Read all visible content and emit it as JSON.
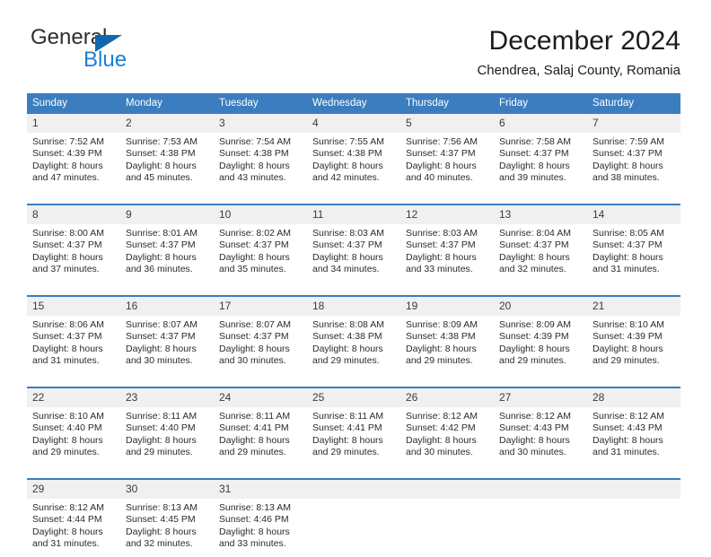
{
  "brand": {
    "name_top": "General",
    "name_bottom": "Blue",
    "color_dark": "#2e2e2e",
    "color_blue": "#1b7fd4",
    "triangle_color": "#1266ae"
  },
  "header": {
    "title": "December 2024",
    "subtitle": "Chendrea, Salaj County, Romania"
  },
  "calendar": {
    "header_bg": "#3b7dbf",
    "day_band_bg": "#f0f0f0",
    "weekdays": [
      "Sunday",
      "Monday",
      "Tuesday",
      "Wednesday",
      "Thursday",
      "Friday",
      "Saturday"
    ],
    "weeks": [
      [
        {
          "day": "1",
          "sunrise": "Sunrise: 7:52 AM",
          "sunset": "Sunset: 4:39 PM",
          "daylight1": "Daylight: 8 hours",
          "daylight2": "and 47 minutes."
        },
        {
          "day": "2",
          "sunrise": "Sunrise: 7:53 AM",
          "sunset": "Sunset: 4:38 PM",
          "daylight1": "Daylight: 8 hours",
          "daylight2": "and 45 minutes."
        },
        {
          "day": "3",
          "sunrise": "Sunrise: 7:54 AM",
          "sunset": "Sunset: 4:38 PM",
          "daylight1": "Daylight: 8 hours",
          "daylight2": "and 43 minutes."
        },
        {
          "day": "4",
          "sunrise": "Sunrise: 7:55 AM",
          "sunset": "Sunset: 4:38 PM",
          "daylight1": "Daylight: 8 hours",
          "daylight2": "and 42 minutes."
        },
        {
          "day": "5",
          "sunrise": "Sunrise: 7:56 AM",
          "sunset": "Sunset: 4:37 PM",
          "daylight1": "Daylight: 8 hours",
          "daylight2": "and 40 minutes."
        },
        {
          "day": "6",
          "sunrise": "Sunrise: 7:58 AM",
          "sunset": "Sunset: 4:37 PM",
          "daylight1": "Daylight: 8 hours",
          "daylight2": "and 39 minutes."
        },
        {
          "day": "7",
          "sunrise": "Sunrise: 7:59 AM",
          "sunset": "Sunset: 4:37 PM",
          "daylight1": "Daylight: 8 hours",
          "daylight2": "and 38 minutes."
        }
      ],
      [
        {
          "day": "8",
          "sunrise": "Sunrise: 8:00 AM",
          "sunset": "Sunset: 4:37 PM",
          "daylight1": "Daylight: 8 hours",
          "daylight2": "and 37 minutes."
        },
        {
          "day": "9",
          "sunrise": "Sunrise: 8:01 AM",
          "sunset": "Sunset: 4:37 PM",
          "daylight1": "Daylight: 8 hours",
          "daylight2": "and 36 minutes."
        },
        {
          "day": "10",
          "sunrise": "Sunrise: 8:02 AM",
          "sunset": "Sunset: 4:37 PM",
          "daylight1": "Daylight: 8 hours",
          "daylight2": "and 35 minutes."
        },
        {
          "day": "11",
          "sunrise": "Sunrise: 8:03 AM",
          "sunset": "Sunset: 4:37 PM",
          "daylight1": "Daylight: 8 hours",
          "daylight2": "and 34 minutes."
        },
        {
          "day": "12",
          "sunrise": "Sunrise: 8:03 AM",
          "sunset": "Sunset: 4:37 PM",
          "daylight1": "Daylight: 8 hours",
          "daylight2": "and 33 minutes."
        },
        {
          "day": "13",
          "sunrise": "Sunrise: 8:04 AM",
          "sunset": "Sunset: 4:37 PM",
          "daylight1": "Daylight: 8 hours",
          "daylight2": "and 32 minutes."
        },
        {
          "day": "14",
          "sunrise": "Sunrise: 8:05 AM",
          "sunset": "Sunset: 4:37 PM",
          "daylight1": "Daylight: 8 hours",
          "daylight2": "and 31 minutes."
        }
      ],
      [
        {
          "day": "15",
          "sunrise": "Sunrise: 8:06 AM",
          "sunset": "Sunset: 4:37 PM",
          "daylight1": "Daylight: 8 hours",
          "daylight2": "and 31 minutes."
        },
        {
          "day": "16",
          "sunrise": "Sunrise: 8:07 AM",
          "sunset": "Sunset: 4:37 PM",
          "daylight1": "Daylight: 8 hours",
          "daylight2": "and 30 minutes."
        },
        {
          "day": "17",
          "sunrise": "Sunrise: 8:07 AM",
          "sunset": "Sunset: 4:37 PM",
          "daylight1": "Daylight: 8 hours",
          "daylight2": "and 30 minutes."
        },
        {
          "day": "18",
          "sunrise": "Sunrise: 8:08 AM",
          "sunset": "Sunset: 4:38 PM",
          "daylight1": "Daylight: 8 hours",
          "daylight2": "and 29 minutes."
        },
        {
          "day": "19",
          "sunrise": "Sunrise: 8:09 AM",
          "sunset": "Sunset: 4:38 PM",
          "daylight1": "Daylight: 8 hours",
          "daylight2": "and 29 minutes."
        },
        {
          "day": "20",
          "sunrise": "Sunrise: 8:09 AM",
          "sunset": "Sunset: 4:39 PM",
          "daylight1": "Daylight: 8 hours",
          "daylight2": "and 29 minutes."
        },
        {
          "day": "21",
          "sunrise": "Sunrise: 8:10 AM",
          "sunset": "Sunset: 4:39 PM",
          "daylight1": "Daylight: 8 hours",
          "daylight2": "and 29 minutes."
        }
      ],
      [
        {
          "day": "22",
          "sunrise": "Sunrise: 8:10 AM",
          "sunset": "Sunset: 4:40 PM",
          "daylight1": "Daylight: 8 hours",
          "daylight2": "and 29 minutes."
        },
        {
          "day": "23",
          "sunrise": "Sunrise: 8:11 AM",
          "sunset": "Sunset: 4:40 PM",
          "daylight1": "Daylight: 8 hours",
          "daylight2": "and 29 minutes."
        },
        {
          "day": "24",
          "sunrise": "Sunrise: 8:11 AM",
          "sunset": "Sunset: 4:41 PM",
          "daylight1": "Daylight: 8 hours",
          "daylight2": "and 29 minutes."
        },
        {
          "day": "25",
          "sunrise": "Sunrise: 8:11 AM",
          "sunset": "Sunset: 4:41 PM",
          "daylight1": "Daylight: 8 hours",
          "daylight2": "and 29 minutes."
        },
        {
          "day": "26",
          "sunrise": "Sunrise: 8:12 AM",
          "sunset": "Sunset: 4:42 PM",
          "daylight1": "Daylight: 8 hours",
          "daylight2": "and 30 minutes."
        },
        {
          "day": "27",
          "sunrise": "Sunrise: 8:12 AM",
          "sunset": "Sunset: 4:43 PM",
          "daylight1": "Daylight: 8 hours",
          "daylight2": "and 30 minutes."
        },
        {
          "day": "28",
          "sunrise": "Sunrise: 8:12 AM",
          "sunset": "Sunset: 4:43 PM",
          "daylight1": "Daylight: 8 hours",
          "daylight2": "and 31 minutes."
        }
      ],
      [
        {
          "day": "29",
          "sunrise": "Sunrise: 8:12 AM",
          "sunset": "Sunset: 4:44 PM",
          "daylight1": "Daylight: 8 hours",
          "daylight2": "and 31 minutes."
        },
        {
          "day": "30",
          "sunrise": "Sunrise: 8:13 AM",
          "sunset": "Sunset: 4:45 PM",
          "daylight1": "Daylight: 8 hours",
          "daylight2": "and 32 minutes."
        },
        {
          "day": "31",
          "sunrise": "Sunrise: 8:13 AM",
          "sunset": "Sunset: 4:46 PM",
          "daylight1": "Daylight: 8 hours",
          "daylight2": "and 33 minutes."
        },
        {
          "day": "",
          "sunrise": "",
          "sunset": "",
          "daylight1": "",
          "daylight2": ""
        },
        {
          "day": "",
          "sunrise": "",
          "sunset": "",
          "daylight1": "",
          "daylight2": ""
        },
        {
          "day": "",
          "sunrise": "",
          "sunset": "",
          "daylight1": "",
          "daylight2": ""
        },
        {
          "day": "",
          "sunrise": "",
          "sunset": "",
          "daylight1": "",
          "daylight2": ""
        }
      ]
    ]
  }
}
